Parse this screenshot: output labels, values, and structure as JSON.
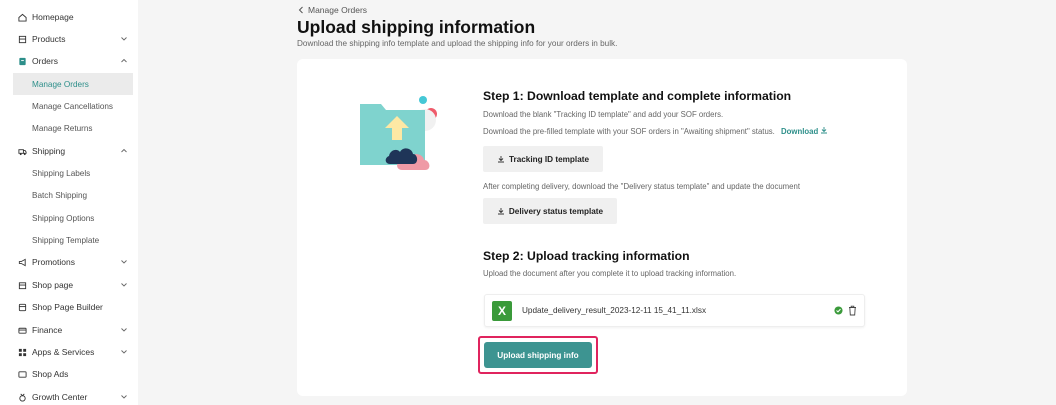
{
  "sidebar": {
    "items": [
      {
        "label": "Homepage",
        "icon": "home-icon"
      },
      {
        "label": "Products",
        "icon": "box-icon"
      },
      {
        "label": "Orders",
        "icon": "orders-icon"
      },
      {
        "label": "Manage Orders"
      },
      {
        "label": "Manage Cancellations"
      },
      {
        "label": "Manage Returns"
      },
      {
        "label": "Shipping",
        "icon": "truck-icon"
      },
      {
        "label": "Shipping Labels"
      },
      {
        "label": "Batch Shipping"
      },
      {
        "label": "Shipping Options"
      },
      {
        "label": "Shipping Template"
      },
      {
        "label": "Promotions",
        "icon": "megaphone-icon"
      },
      {
        "label": "Shop page",
        "icon": "shop-icon"
      },
      {
        "label": "Shop Page Builder",
        "icon": "builder-icon"
      },
      {
        "label": "Finance",
        "icon": "card-icon"
      },
      {
        "label": "Apps & Services",
        "icon": "apps-icon"
      },
      {
        "label": "Shop Ads",
        "icon": "ads-icon"
      },
      {
        "label": "Growth Center",
        "icon": "medal-icon"
      }
    ],
    "active": "Manage Orders"
  },
  "header": {
    "breadcrumb": "Manage Orders",
    "title": "Upload shipping information",
    "subtitle": "Download the shipping info template and upload the shipping info for your orders in bulk."
  },
  "step1": {
    "title": "Step 1: Download template and complete information",
    "line1": "Download the blank \"Tracking ID template\" and add your SOF orders.",
    "line2": "Download the pre-filled template with your SOF orders in \"Awaiting shipment\" status.",
    "download_link": "Download",
    "tracking_button": "Tracking ID template",
    "line3": "After completing delivery, download the \"Delivery status template\" and update the document",
    "delivery_button": "Delivery status template"
  },
  "step2": {
    "title": "Step 2: Upload tracking information",
    "line1": "Upload the document after you complete it to upload tracking information.",
    "file_icon_letter": "X",
    "file_name": "Update_delivery_result_2023-12-11 15_41_11.xlsx",
    "upload_button": "Upload shipping info"
  },
  "colors": {
    "accent": "#2d8f8a",
    "upload_button": "#3d9491",
    "highlight": "#e0245e",
    "excel": "#3a9a3a"
  }
}
